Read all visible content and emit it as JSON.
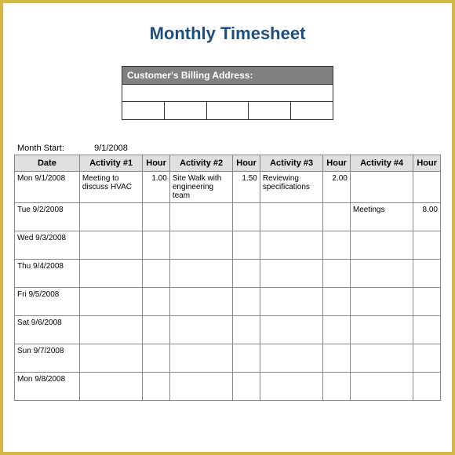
{
  "title": "Monthly Timesheet",
  "billing": {
    "header": "Customer's Billing Address:"
  },
  "month_start": {
    "label": "Month Start:",
    "value": "9/1/2008"
  },
  "headers": {
    "date": "Date",
    "activity1": "Activity #1",
    "hour1": "Hour",
    "activity2": "Activity #2",
    "hour2": "Hour",
    "activity3": "Activity #3",
    "hour3": "Hour",
    "activity4": "Activity #4",
    "hour4": "Hour"
  },
  "rows": [
    {
      "date": "Mon 9/1/2008",
      "a1": "Meeting to discuss HVAC",
      "h1": "1.00",
      "a2": "Site Walk with engineering team",
      "h2": "1.50",
      "a3": "Reviewing specifications",
      "h3": "2.00",
      "a4": "",
      "h4": ""
    },
    {
      "date": "Tue 9/2/2008",
      "a1": "",
      "h1": "",
      "a2": "",
      "h2": "",
      "a3": "",
      "h3": "",
      "a4": "Meetings",
      "h4": "8.00"
    },
    {
      "date": "Wed 9/3/2008",
      "a1": "",
      "h1": "",
      "a2": "",
      "h2": "",
      "a3": "",
      "h3": "",
      "a4": "",
      "h4": ""
    },
    {
      "date": "Thu 9/4/2008",
      "a1": "",
      "h1": "",
      "a2": "",
      "h2": "",
      "a3": "",
      "h3": "",
      "a4": "",
      "h4": ""
    },
    {
      "date": "Fri 9/5/2008",
      "a1": "",
      "h1": "",
      "a2": "",
      "h2": "",
      "a3": "",
      "h3": "",
      "a4": "",
      "h4": ""
    },
    {
      "date": "Sat 9/6/2008",
      "a1": "",
      "h1": "",
      "a2": "",
      "h2": "",
      "a3": "",
      "h3": "",
      "a4": "",
      "h4": ""
    },
    {
      "date": "Sun 9/7/2008",
      "a1": "",
      "h1": "",
      "a2": "",
      "h2": "",
      "a3": "",
      "h3": "",
      "a4": "",
      "h4": ""
    },
    {
      "date": "Mon 9/8/2008",
      "a1": "",
      "h1": "",
      "a2": "",
      "h2": "",
      "a3": "",
      "h3": "",
      "a4": "",
      "h4": ""
    }
  ]
}
